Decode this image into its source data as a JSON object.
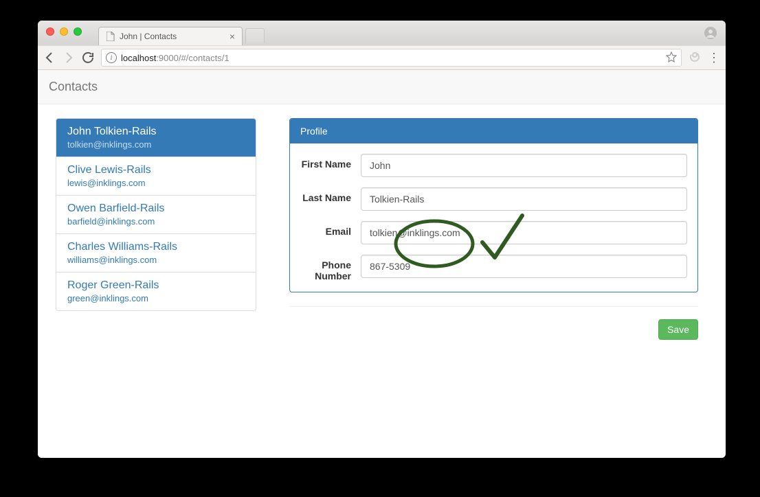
{
  "browser": {
    "tab_title": "John | Contacts",
    "url_host": "localhost",
    "url_port_path": ":9000/#/contacts/1"
  },
  "navbar": {
    "brand": "Contacts"
  },
  "contacts": [
    {
      "name": "John Tolkien-Rails",
      "email": "tolkien@inklings.com",
      "active": true
    },
    {
      "name": "Clive Lewis-Rails",
      "email": "lewis@inklings.com",
      "active": false
    },
    {
      "name": "Owen Barfield-Rails",
      "email": "barfield@inklings.com",
      "active": false
    },
    {
      "name": "Charles Williams-Rails",
      "email": "williams@inklings.com",
      "active": false
    },
    {
      "name": "Roger Green-Rails",
      "email": "green@inklings.com",
      "active": false
    }
  ],
  "profile": {
    "heading": "Profile",
    "first_name_label": "First Name",
    "last_name_label": "Last Name",
    "email_label": "Email",
    "phone_label": "Phone Number",
    "first_name": "John",
    "last_name": "Tolkien-Rails",
    "email": "tolkien@inklings.com",
    "phone": "867-5309"
  },
  "buttons": {
    "save": "Save"
  }
}
